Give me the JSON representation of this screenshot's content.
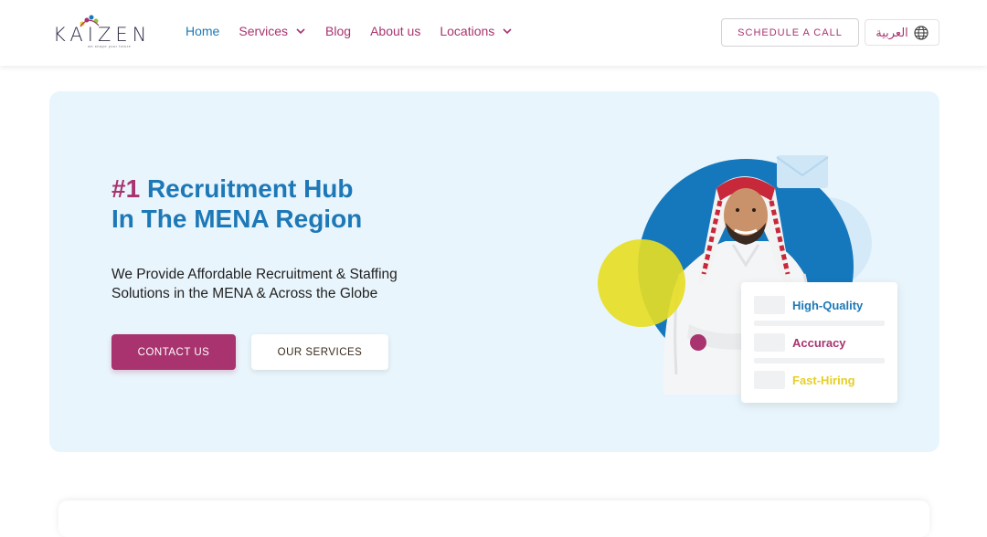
{
  "logo": {
    "text": "KAIZEN",
    "tagline": "we shape your future"
  },
  "nav": {
    "items": [
      {
        "label": "Home",
        "active": true,
        "dropdown": false
      },
      {
        "label": "Services",
        "active": false,
        "dropdown": true
      },
      {
        "label": "Blog",
        "active": false,
        "dropdown": false
      },
      {
        "label": "About us",
        "active": false,
        "dropdown": false
      },
      {
        "label": "Locations",
        "active": false,
        "dropdown": true
      }
    ]
  },
  "header": {
    "schedule_label": "SCHEDULE A CALL",
    "lang_label": "العربية",
    "lang_icon": "globe-icon"
  },
  "hero": {
    "title_number": "#1",
    "title_line1": "Recruitment Hub",
    "title_line2": "In The MENA Region",
    "subtitle_line1": "We Provide Affordable Recruitment & Staffing",
    "subtitle_line2": "Solutions in the MENA & Across the Globe",
    "contact_label": "CONTACT US",
    "services_label": "OUR SERVICES"
  },
  "features": [
    {
      "label": "High-Quality",
      "color": "#1d78b7"
    },
    {
      "label": "Accuracy",
      "color": "#a8336f"
    },
    {
      "label": "Fast-Hiring",
      "color": "#e6cf27"
    }
  ],
  "colors": {
    "brand_magenta": "#a8336f",
    "brand_blue": "#1d78b7",
    "accent_yellow": "#e6dd26",
    "hero_bg": "#e9f5fc"
  }
}
